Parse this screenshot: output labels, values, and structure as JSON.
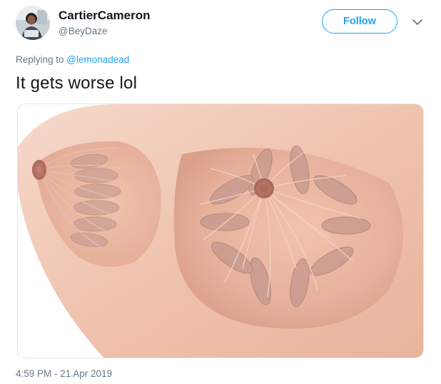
{
  "tweet": {
    "author_name": "CartierCameron",
    "author_handle": "@BeyDaze",
    "follow_label": "Follow",
    "reply_prefix": "Replying to ",
    "reply_to": "@lemonadead",
    "text": "It gets worse lol",
    "timestamp": "4:59 PM - 21 Apr 2019",
    "media_subject": "anatomical illustration of breast mammary glands and ducts"
  },
  "icons": {
    "avatar": "user-avatar",
    "caret": "chevron-down-icon"
  },
  "colors": {
    "accent": "#1da1f2",
    "text_primary": "#14171a",
    "text_secondary": "#657786",
    "border": "#e1e8ed"
  }
}
